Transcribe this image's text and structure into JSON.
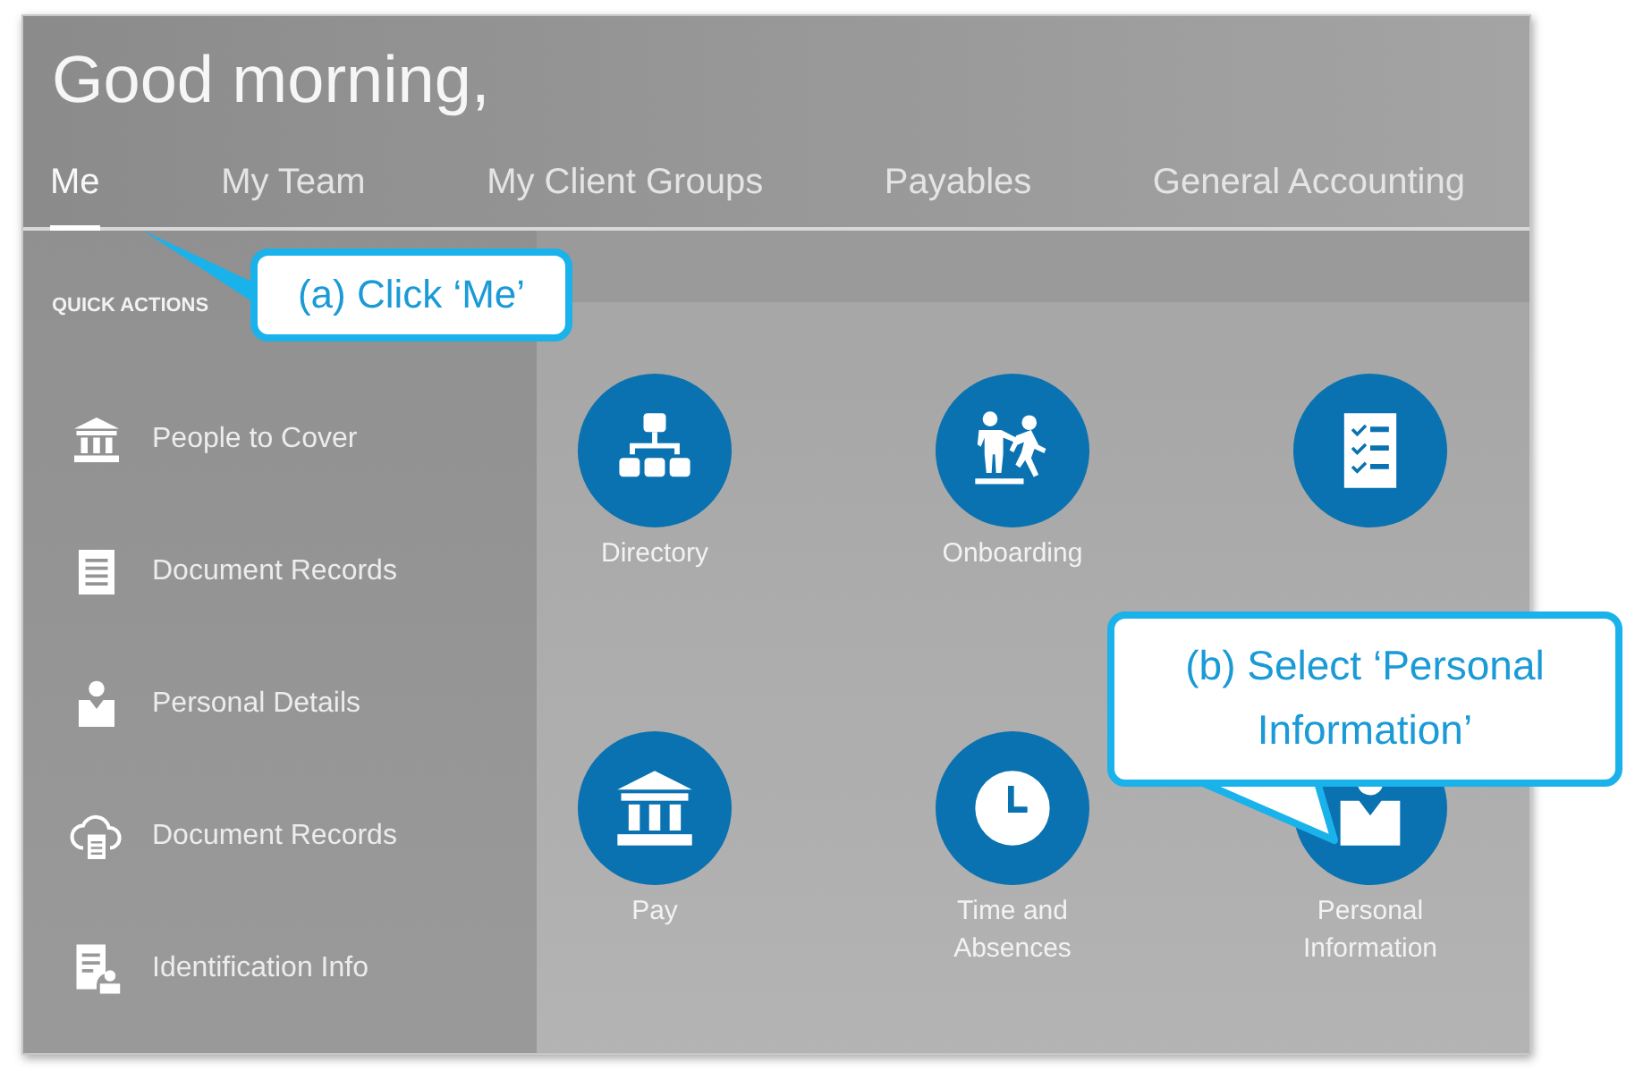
{
  "header": {
    "greeting": "Good morning,"
  },
  "tabs": [
    {
      "label": "Me",
      "selected": true
    },
    {
      "label": "My Team",
      "selected": false
    },
    {
      "label": "My Client Groups",
      "selected": false
    },
    {
      "label": "Payables",
      "selected": false
    },
    {
      "label": "General Accounting",
      "selected": false
    }
  ],
  "quick_actions": {
    "heading": "QUICK ACTIONS",
    "items": [
      {
        "label": "People to Cover",
        "kind": "bank"
      },
      {
        "label": "Document Records",
        "kind": "document"
      },
      {
        "label": "Personal Details",
        "kind": "person"
      },
      {
        "label": "Document Records",
        "kind": "cloud"
      },
      {
        "label": "Identification Info",
        "kind": "id"
      }
    ]
  },
  "tiles": [
    {
      "label": "Directory",
      "kind": "org"
    },
    {
      "label": "Onboarding",
      "kind": "onboard"
    },
    {
      "kind": "checklist"
    },
    {
      "label": "Pay",
      "kind": "bank"
    },
    {
      "label": "Time and Absences",
      "kind": "clock"
    },
    {
      "label": "Personal Information",
      "kind": "person"
    }
  ],
  "callouts": [
    {
      "text": "(a) Click ‘Me’"
    },
    {
      "text": "(b) Select ‘Personal Information’"
    }
  ]
}
